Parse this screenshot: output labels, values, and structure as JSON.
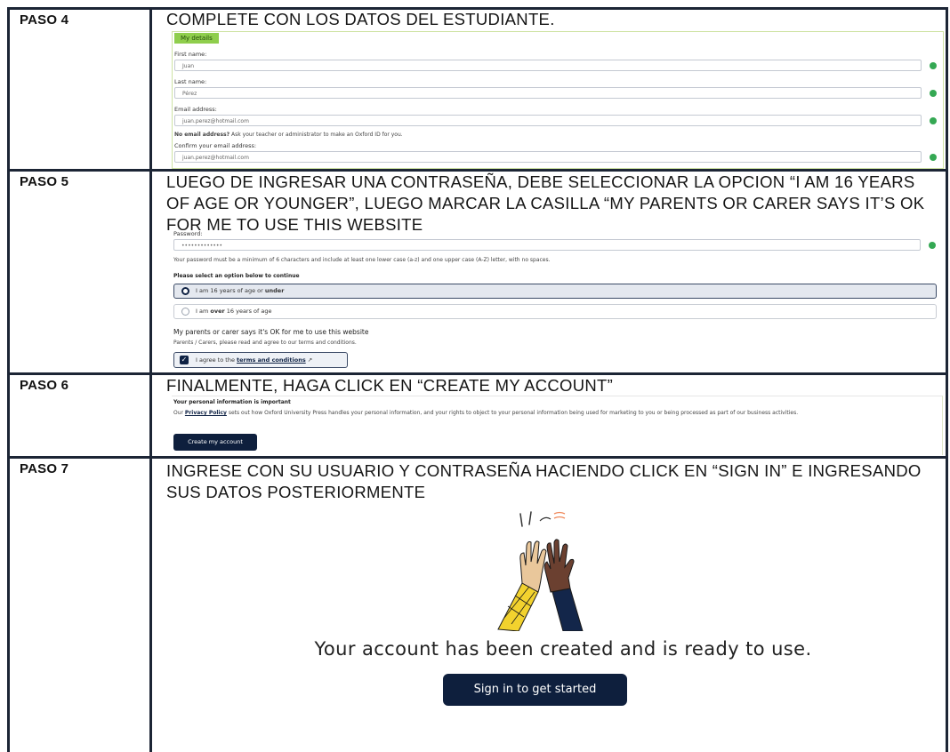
{
  "steps": [
    {
      "label": "PASO 4",
      "instruction": "COMPLETE CON LOS DATOS DEL ESTUDIANTE."
    },
    {
      "label": "PASO 5",
      "instruction": "LUEGO DE INGRESAR UNA CONTRASEÑA, DEBE SELECCIONAR LA OPCION “I AM 16 YEARS OF AGE OR YOUNGER”, LUEGO MARCAR LA CASILLA “MY PARENTS OR CARER SAYS IT’S OK  FOR ME TO USE THIS WEBSITE"
    },
    {
      "label": "PASO 6",
      "instruction": "FINALMENTE, HAGA CLICK EN “CREATE MY ACCOUNT”"
    },
    {
      "label": "PASO 7",
      "instruction": "INGRESE CON SU USUARIO Y CONTRASEÑA HACIENDO CLICK EN “SIGN IN” E INGRESANDO SUS DATOS POSTERIORMENTE"
    }
  ],
  "details_form": {
    "tab": "My details",
    "first_name_label": "First name:",
    "first_name_value": "Juan",
    "last_name_label": "Last name:",
    "last_name_value": "Pérez",
    "email_label": "Email address:",
    "email_value": "juan.perez@hotmail.com",
    "no_email_bold": "No email address?",
    "no_email_text": "Ask your teacher or administrator to make an Oxford ID for you.",
    "confirm_label": "Confirm your email address:",
    "confirm_value": "juan.perez@hotmail.com"
  },
  "password_form": {
    "password_label": "Password:",
    "password_value": "•••••••••••••",
    "hint": "Your password must be a minimum of 6 characters and include at least one lower case (a-z) and one upper case (A-Z) letter, with no spaces.",
    "select_heading": "Please select an option below to continue",
    "option_under_prefix": "I am 16 years of age or ",
    "option_under_bold": "under",
    "option_over_prefix": "I am ",
    "option_over_bold": "over",
    "option_over_suffix": " 16 years of age",
    "parents_heading": "My parents or carer says it's OK for me to use this website",
    "parents_sub": "Parents / Carers, please read and agree to our terms and conditions.",
    "agree_prefix": "I agree to the ",
    "agree_link": "terms and conditions",
    "external_glyph": "↗"
  },
  "create_account": {
    "heading": "Your personal information is important",
    "text_prefix": "Our ",
    "privacy_link": "Privacy Policy",
    "text_rest": " sets out how Oxford University Press handles your personal information, and your rights to object to your personal information being used for marketing to you or being processed as part of our business activities.",
    "button": "Create my account"
  },
  "account_created": {
    "message": "Your account has been created and is ready to use.",
    "button": "Sign in to get started"
  },
  "colors": {
    "border": "#1c2535",
    "navy_button": "#0e1f3d",
    "green_tab": "#8fce4c",
    "valid_dot": "#34a853",
    "yellow_sleeve": "#f2d22e"
  }
}
